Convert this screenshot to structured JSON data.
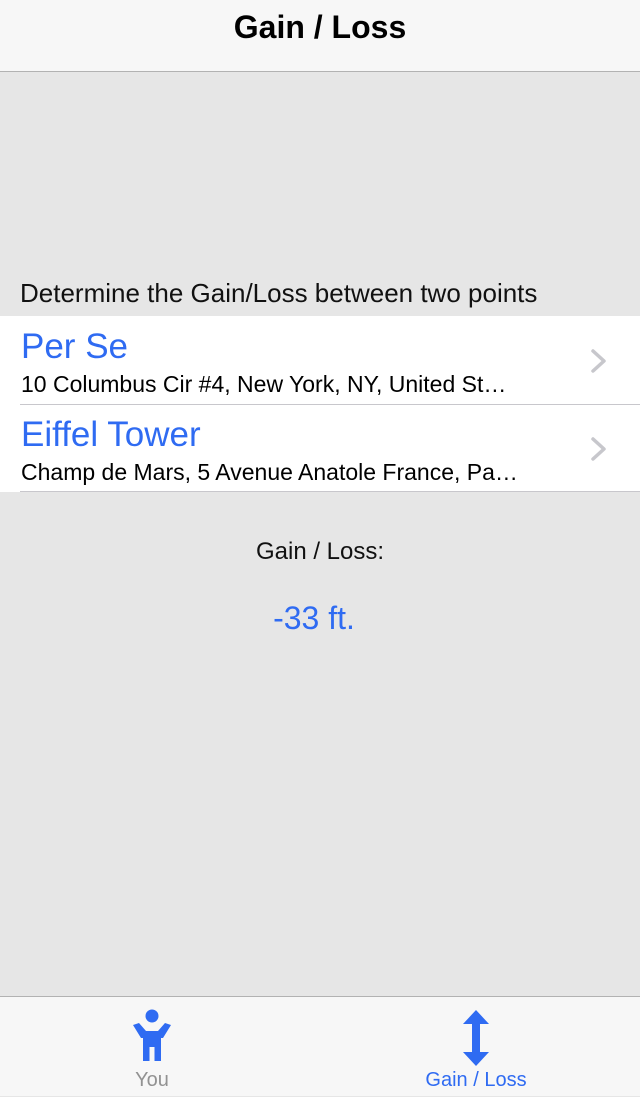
{
  "nav": {
    "title": "Gain / Loss"
  },
  "section": {
    "header": "Determine the Gain/Loss between two points"
  },
  "points": [
    {
      "name": "Per Se",
      "address": "10 Columbus Cir #4, New York, NY, United St…"
    },
    {
      "name": "Eiffel Tower",
      "address": "Champ de Mars, 5 Avenue Anatole France, Pa…"
    }
  ],
  "result": {
    "label": "Gain / Loss:",
    "value": "-33 ft."
  },
  "tabs": [
    {
      "label": "You",
      "icon": "person-icon",
      "selected": false
    },
    {
      "label": "Gain / Loss",
      "icon": "vertical-arrows-icon",
      "selected": true
    }
  ],
  "colors": {
    "accent": "#2f6bf2",
    "background": "#e6e6e6",
    "bar": "#f7f7f7",
    "inactive_tab": "#929292"
  }
}
